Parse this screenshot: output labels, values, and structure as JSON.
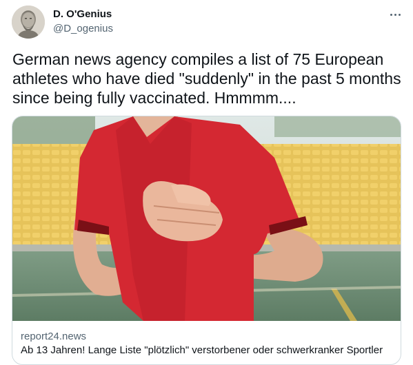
{
  "author": {
    "display_name": "D. O'Genius",
    "handle": "@D_ogenius",
    "avatar_icon": "bust-statue-avatar"
  },
  "more_icon": "more-horizontal-icon",
  "tweet": {
    "text": "German news agency compiles a list of 75 European athletes who have died \"suddenly\" in the past 5 months since being fully vaccinated. Hmmmm...."
  },
  "link_card": {
    "image_description_icon": "athlete-clutching-chest-photo",
    "domain": "report24.news",
    "title": "Ab 13 Jahren! Lange Liste \"plötzlich\" verstorbener oder schwerkranker Sportler"
  },
  "colors": {
    "text_primary": "#0f1419",
    "text_secondary": "#536471",
    "border": "#cfd9de",
    "shirt_red": "#d42832"
  }
}
